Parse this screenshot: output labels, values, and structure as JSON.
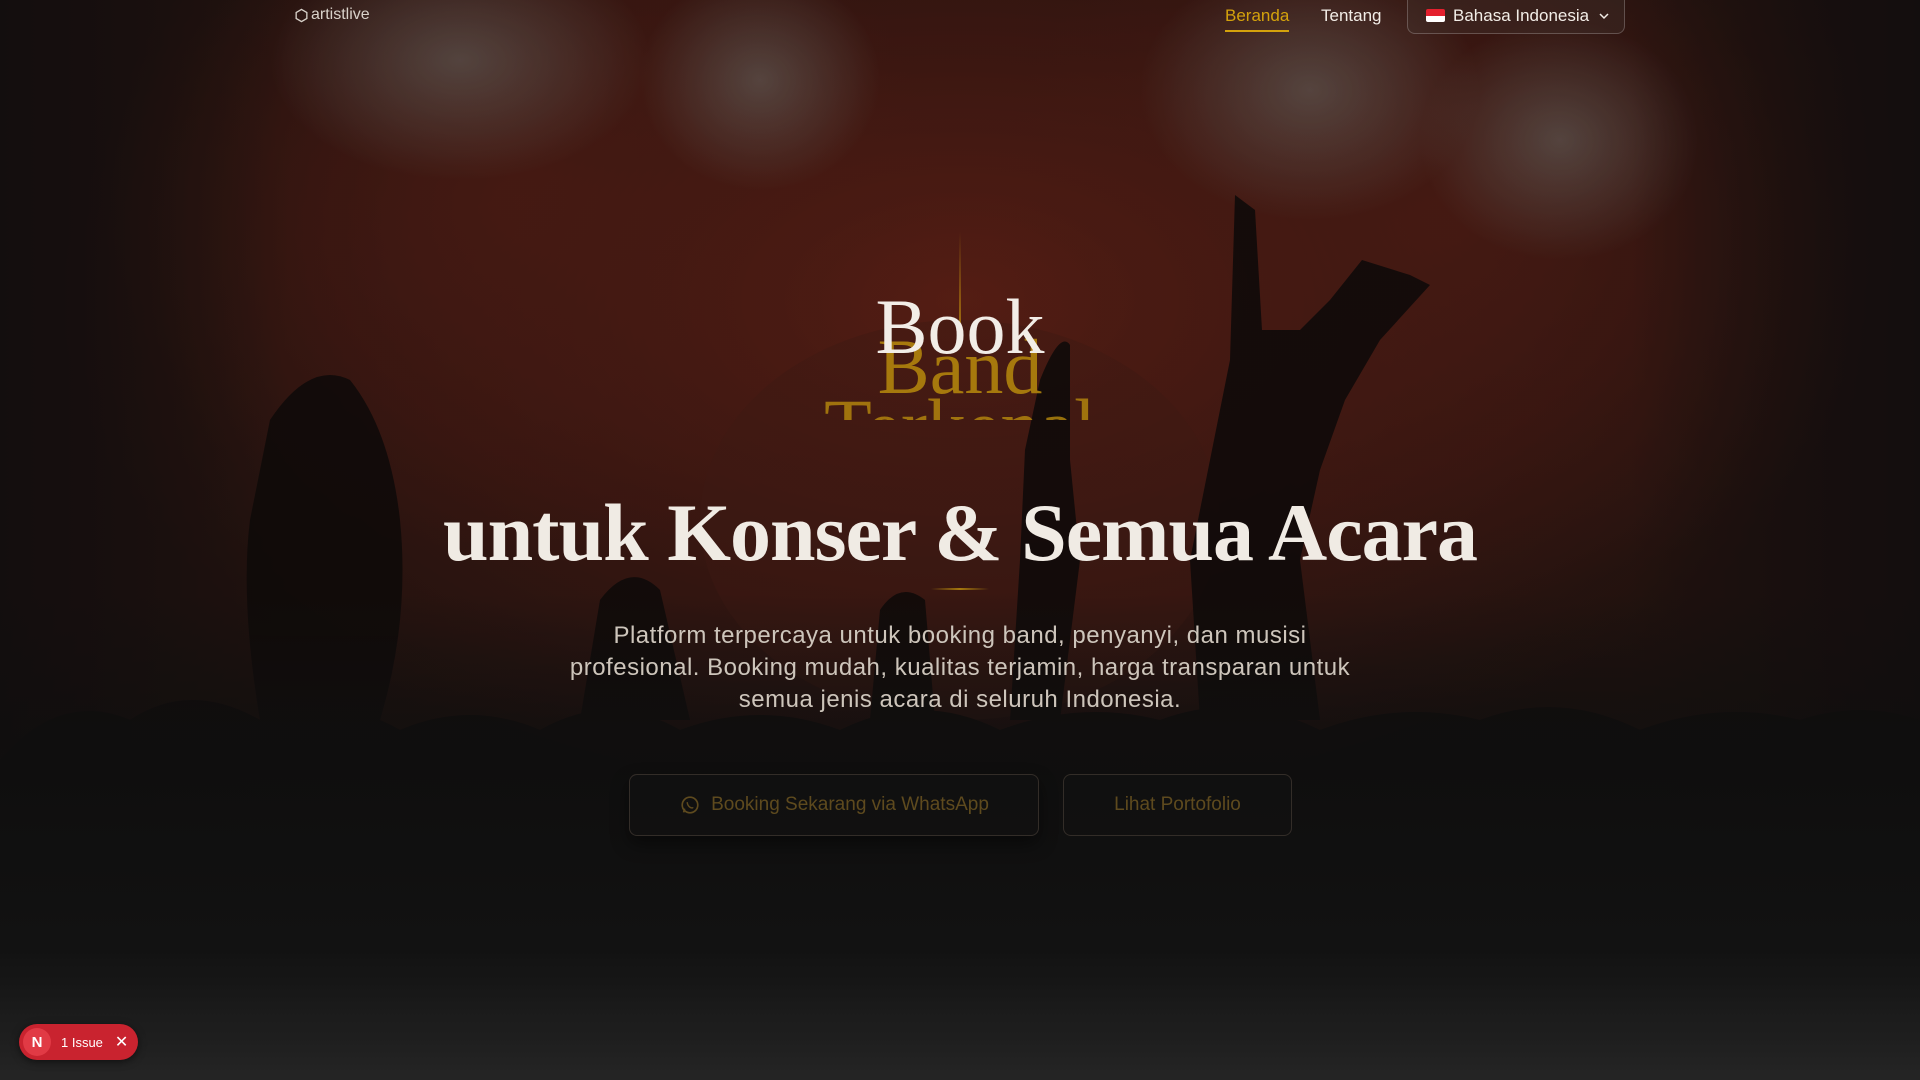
{
  "nav": {
    "logo_text": "artistlive",
    "links": [
      {
        "label": "Beranda",
        "active": true
      },
      {
        "label": "Tentang",
        "active": false
      }
    ],
    "language": {
      "label": "Bahasa Indonesia",
      "flag": "flag-indonesia-icon"
    }
  },
  "hero": {
    "rotating_words": [
      "Book",
      "Band",
      "Terkenal"
    ],
    "headline": "untuk Konser & Semua Acara",
    "subtitle": "Platform terpercaya untuk booking band, penyanyi, dan musisi profesional. Booking mudah, kualitas terjamin, harga transparan untuk semua jenis acara di seluruh Indonesia.",
    "primary_cta": "Booking Sekarang via WhatsApp",
    "secondary_cta": "Lihat Portofolio"
  },
  "dev_overlay": {
    "badge_letter": "N",
    "issue_label": "1 Issue"
  },
  "colors": {
    "accent": "#d4a20c",
    "background": "#141414",
    "issue_red": "#c9232f"
  }
}
